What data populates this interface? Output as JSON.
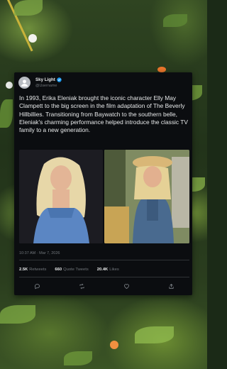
{
  "post": {
    "author_name": "Sky Light",
    "author_handle": "@Username",
    "text": "In 1993, Erika Eleniak brought the iconic character Elly May Clampett to the big screen in the film adaptation of The Beverly Hillbillies. Transitioning from Baywatch to the southern belle, Eleniak's charming performance helped introduce the classic TV family to a new generation.",
    "timestamp": "10:37 AM · Mar 7, 2026",
    "stats": {
      "retweets_count": "2.5K",
      "retweets_label": "Retweets",
      "quotes_count": "660",
      "quotes_label": "Quote Tweets",
      "likes_count": "20.4K",
      "likes_label": "Likes"
    }
  },
  "theme": {
    "card_bg": "#0b0d10",
    "text_primary": "#e7e9ea",
    "text_secondary": "#71767b",
    "verified_color": "#1d9bf0"
  },
  "icons": [
    "avatar-person-icon",
    "verified-badge-icon",
    "reply-icon",
    "retweet-icon",
    "like-icon",
    "share-icon"
  ]
}
